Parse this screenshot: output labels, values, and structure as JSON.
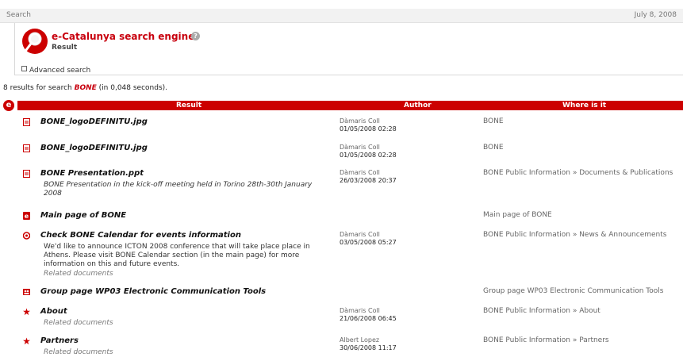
{
  "topbar": {
    "breadcrumb": "Search",
    "date": "July 8, 2008"
  },
  "header": {
    "title": "e-Catalunya search engine",
    "help_icon": "?",
    "subtitle": "Result",
    "advanced_search": "Advanced search"
  },
  "summary": {
    "prefix": "8 results for search ",
    "query": "BONE",
    "suffix": " (in 0,048 seconds)."
  },
  "table": {
    "badge": "e",
    "columns": {
      "result": "Result",
      "author": "Author",
      "where": "Where is it"
    },
    "rows": [
      {
        "icon": "document-icon",
        "title": "BONE_logoDEFINITU.jpg",
        "author": "Dàmaris Coll",
        "date": "01/05/2008 02:28",
        "where": "BONE"
      },
      {
        "icon": "document-icon",
        "title": "BONE_logoDEFINITU.jpg",
        "author": "Dàmaris Coll",
        "date": "01/05/2008 02:28",
        "where": "BONE"
      },
      {
        "icon": "document-icon",
        "title": "BONE Presentation.ppt",
        "description": "BONE Presentation in the kick-off meeting held in Torino 28th-30th January 2008",
        "author": "Dàmaris Coll",
        "date": "26/03/2008 20:37",
        "where": "BONE Public Information » Documents & Publications"
      },
      {
        "icon": "e-page-icon",
        "title": "Main page of BONE",
        "where": "Main page of BONE"
      },
      {
        "icon": "announcement-icon",
        "title": "Check BONE Calendar for events information",
        "description": "We'd like to announce ICTON 2008 conference that  will take place place in Athens. Please visit BONE Calendar section (in the main page) for more information on this and future events.",
        "related": "Related documents",
        "author": "Dàmaris Coll",
        "date": "03/05/2008 05:27",
        "where": "BONE Public Information » News & Announcements"
      },
      {
        "icon": "group-icon",
        "title": "Group page WP03 Electronic Communication Tools",
        "where": "Group page WP03 Electronic Communication Tools"
      },
      {
        "icon": "star-icon",
        "title": "About",
        "related": "Related documents",
        "author": "Dàmaris Coll",
        "date": "21/06/2008 06:45",
        "where": "BONE Public Information » About"
      },
      {
        "icon": "star-icon",
        "title": "Partners",
        "related": "Related documents",
        "author": "Albert Lopez",
        "date": "30/06/2008 11:17",
        "where": "BONE Public Information » Partners"
      }
    ]
  },
  "colors": {
    "accent": "#cc0000",
    "muted_text": "#666666"
  }
}
